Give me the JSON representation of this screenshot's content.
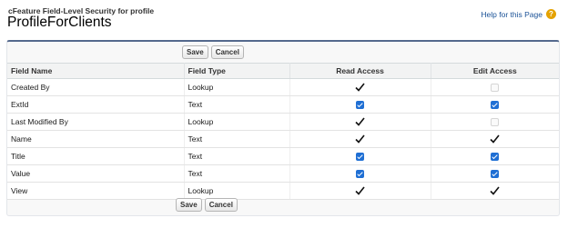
{
  "header": {
    "pre_title": "cFeature Field-Level Security for profile",
    "title": "ProfileForClients",
    "help_link": "Help for this Page",
    "help_icon": "?"
  },
  "buttons": {
    "save": "Save",
    "cancel": "Cancel"
  },
  "table": {
    "columns": [
      "Field Name",
      "Field Type",
      "Read Access",
      "Edit Access"
    ],
    "rows": [
      {
        "field_name": "Created By",
        "field_type": "Lookup",
        "read": "checkmark",
        "edit": "disabled"
      },
      {
        "field_name": "ExtId",
        "field_type": "Text",
        "read": "checked",
        "edit": "checked"
      },
      {
        "field_name": "Last Modified By",
        "field_type": "Lookup",
        "read": "checkmark",
        "edit": "disabled"
      },
      {
        "field_name": "Name",
        "field_type": "Text",
        "read": "checkmark",
        "edit": "checkmark"
      },
      {
        "field_name": "Title",
        "field_type": "Text",
        "read": "checked",
        "edit": "checked"
      },
      {
        "field_name": "Value",
        "field_type": "Text",
        "read": "checked",
        "edit": "checked"
      },
      {
        "field_name": "View",
        "field_type": "Lookup",
        "read": "checkmark",
        "edit": "checkmark"
      }
    ]
  },
  "colors": {
    "accent": "#54698d",
    "checkbox": "#1f6fd4",
    "link": "#1b5297",
    "help_icon": "#e5a200"
  }
}
